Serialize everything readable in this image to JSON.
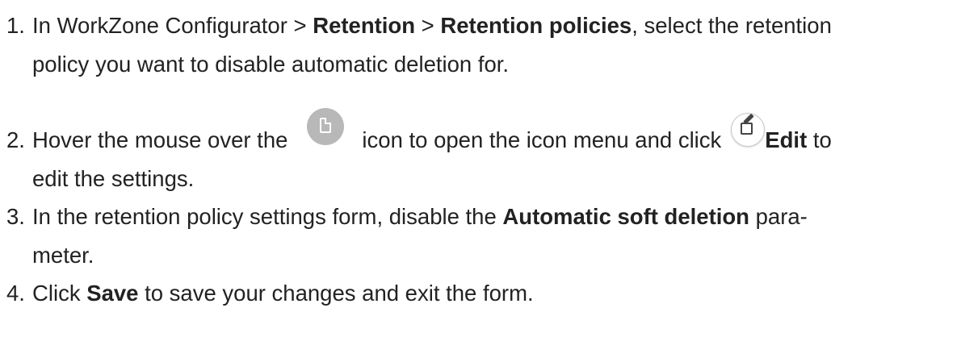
{
  "steps": [
    {
      "number": "1.",
      "line1_prefix": "In WorkZone Configurator  > ",
      "bold1": "Retention",
      "sep": " > ",
      "bold2": "Retention policies",
      "line1_suffix": ", select the retention",
      "line2": "policy you want to disable automatic deletion for."
    },
    {
      "number": "2.",
      "text_before_icon": "Hover the mouse over the",
      "icon1": "document-icon",
      "text_after_icon": "icon to open the icon menu and click",
      "icon2": "edit-icon",
      "bold": "Edit",
      "suffix": " to",
      "line2": "edit the settings."
    },
    {
      "number": "3.",
      "prefix": "In the retention policy settings form, disable the ",
      "bold": "Automatic soft deletion",
      "suffix": " para-",
      "line2": "meter."
    },
    {
      "number": "4.",
      "prefix": "Click ",
      "bold": "Save",
      "suffix": " to save your changes and exit the form."
    }
  ]
}
